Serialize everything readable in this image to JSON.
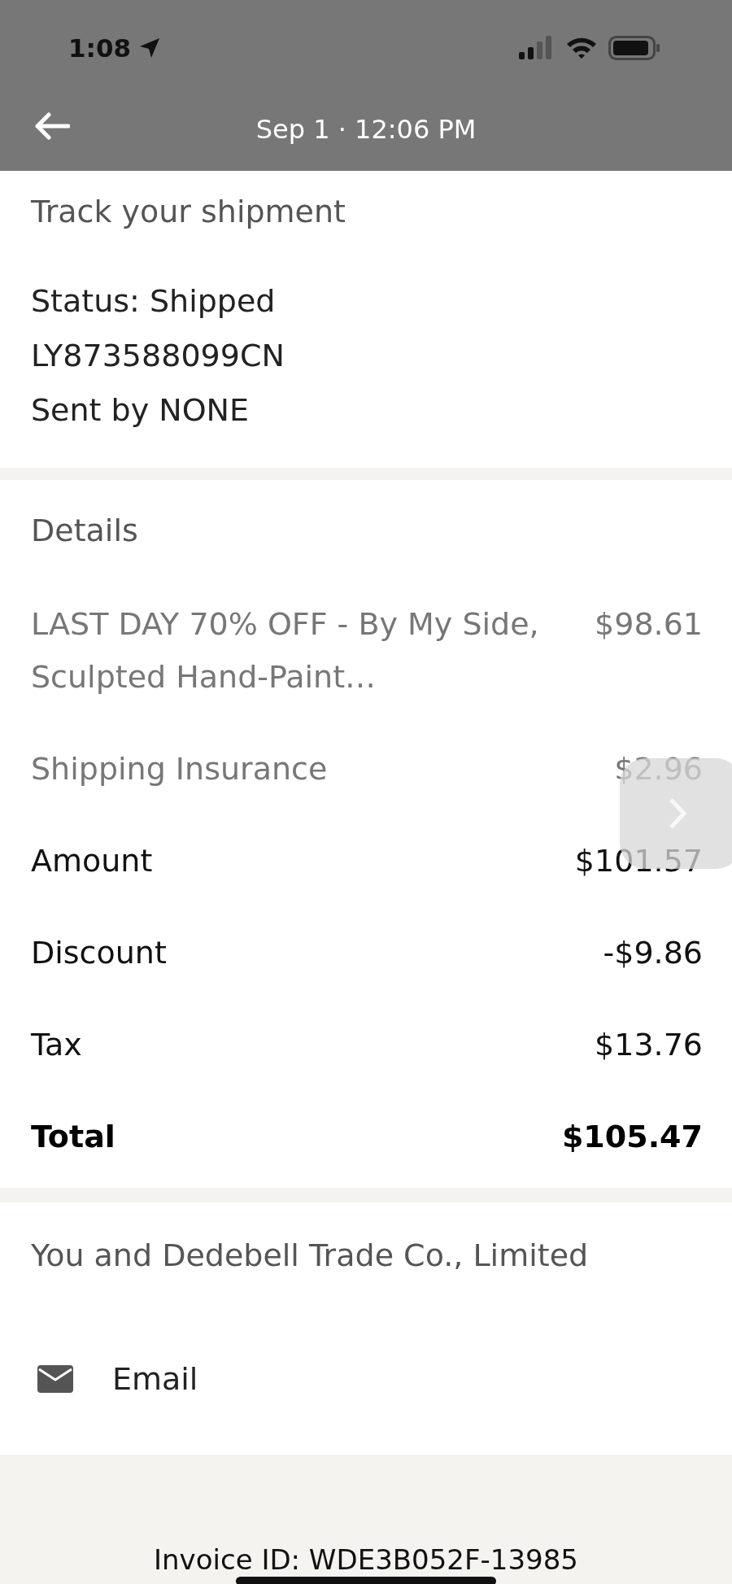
{
  "status_bar": {
    "time": "1:08"
  },
  "nav": {
    "title": "Sep 1 · 12:06 PM"
  },
  "tracking": {
    "heading": "Track your shipment",
    "lines": [
      "Status: Shipped",
      "LY873588099CN",
      "Sent by NONE"
    ]
  },
  "details": {
    "heading": "Details",
    "rows": [
      {
        "kind": "item",
        "label": "LAST DAY 70% OFF - By My Side, Sculpted Hand-Paint…",
        "amount": "$98.61"
      },
      {
        "kind": "item",
        "label": "Shipping Insurance",
        "amount": "$2.96"
      },
      {
        "kind": "summary",
        "label": "Amount",
        "amount": "$101.57"
      },
      {
        "kind": "summary",
        "label": "Discount",
        "amount": "-$9.86"
      },
      {
        "kind": "summary",
        "label": "Tax",
        "amount": "$13.76"
      },
      {
        "kind": "total",
        "label": "Total",
        "amount": "$105.47"
      }
    ]
  },
  "contact": {
    "heading": "You and Dedebell Trade Co., Limited",
    "actions": [
      {
        "label": "Email"
      }
    ]
  },
  "footer": {
    "invoice": "Invoice ID: WDE3B052F-13985"
  }
}
